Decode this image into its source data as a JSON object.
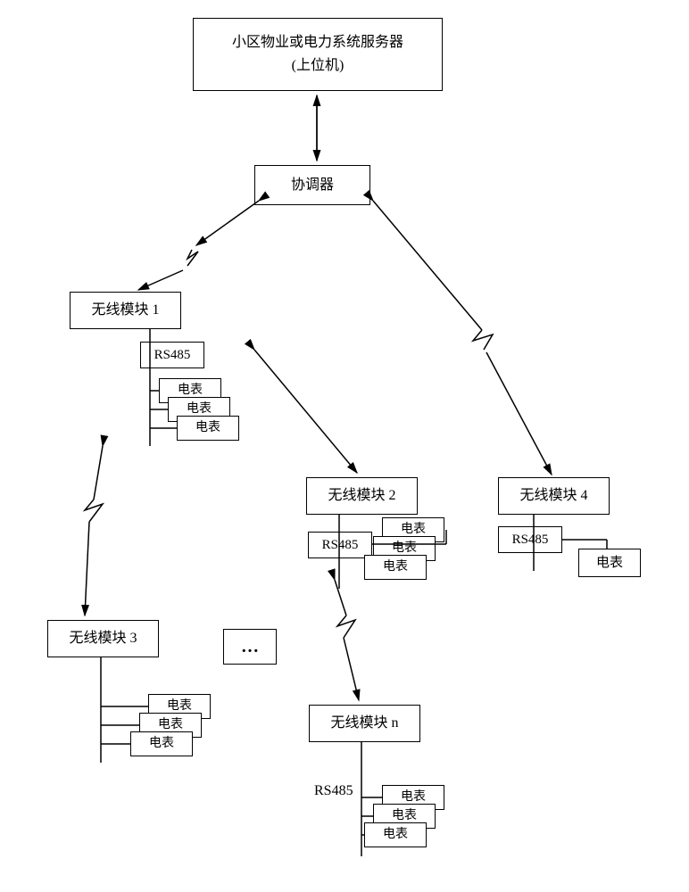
{
  "server": {
    "line1": "小区物业或电力系统服务器",
    "line2": "(上位机)"
  },
  "coordinator": "协调器",
  "modules": {
    "m1": "无线模块 1",
    "m2": "无线模块 2",
    "m3": "无线模块 3",
    "m4": "无线模块 4",
    "mn": "无线模块 n"
  },
  "bus": "RS485",
  "meter": "电表",
  "ellipsis": "…"
}
